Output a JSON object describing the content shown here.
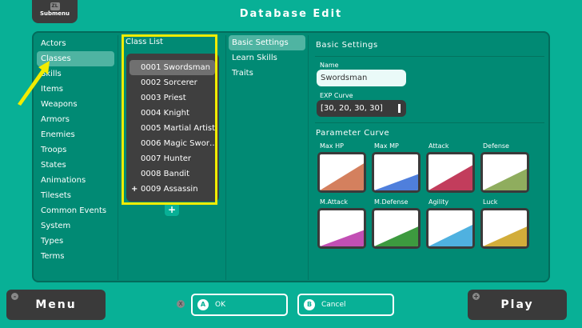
{
  "header": {
    "submenu_icon": "ZL",
    "submenu_label": "Submenu",
    "title": "Database Edit"
  },
  "sidebar": {
    "items": [
      "Actors",
      "Classes",
      "Skills",
      "Items",
      "Weapons",
      "Armors",
      "Enemies",
      "Troops",
      "States",
      "Animations",
      "Tilesets",
      "Common Events",
      "System",
      "Types",
      "Terms"
    ],
    "selected": "Classes"
  },
  "class_list": {
    "title": "Class List",
    "items": [
      "0001 Swordsman",
      "0002 Sorcerer",
      "0003 Priest",
      "0004 Knight",
      "0005 Martial Artist",
      "0006 Magic Swor…",
      "0007 Hunter",
      "0008 Bandit",
      "0009 Assassin"
    ],
    "selected": "0001 Swordsman",
    "add_label": "+"
  },
  "tabs": {
    "items": [
      "Basic Settings",
      "Learn Skills",
      "Traits"
    ],
    "selected": "Basic Settings"
  },
  "settings": {
    "title": "Basic Settings",
    "name_label": "Name",
    "name_value": "Swordsman",
    "exp_label": "EXP Curve",
    "exp_value": "[30, 20, 30, 30]",
    "param_title": "Parameter Curve",
    "params": [
      {
        "label": "Max HP",
        "color": "#d4805e",
        "level": 0.75
      },
      {
        "label": "Max MP",
        "color": "#4f7fdc",
        "level": 0.45
      },
      {
        "label": "Attack",
        "color": "#c23d5c",
        "level": 0.7
      },
      {
        "label": "Defense",
        "color": "#8fad5e",
        "level": 0.6
      },
      {
        "label": "M.Attack",
        "color": "#c24fb4",
        "level": 0.45
      },
      {
        "label": "M.Defense",
        "color": "#3d9a3f",
        "level": 0.55
      },
      {
        "label": "Agility",
        "color": "#4fb1e0",
        "level": 0.6
      },
      {
        "label": "Luck",
        "color": "#d2ad3a",
        "level": 0.55
      }
    ]
  },
  "footer": {
    "menu": "Menu",
    "menu_icon": "-",
    "ok": "OK",
    "ok_key": "A",
    "cancel": "Cancel",
    "cancel_key": "B",
    "x_key": "X",
    "play": "Play",
    "play_icon": "+"
  },
  "colors": {
    "background": "#08b096",
    "panel": "#018a74",
    "highlight": "#f2ec00"
  }
}
